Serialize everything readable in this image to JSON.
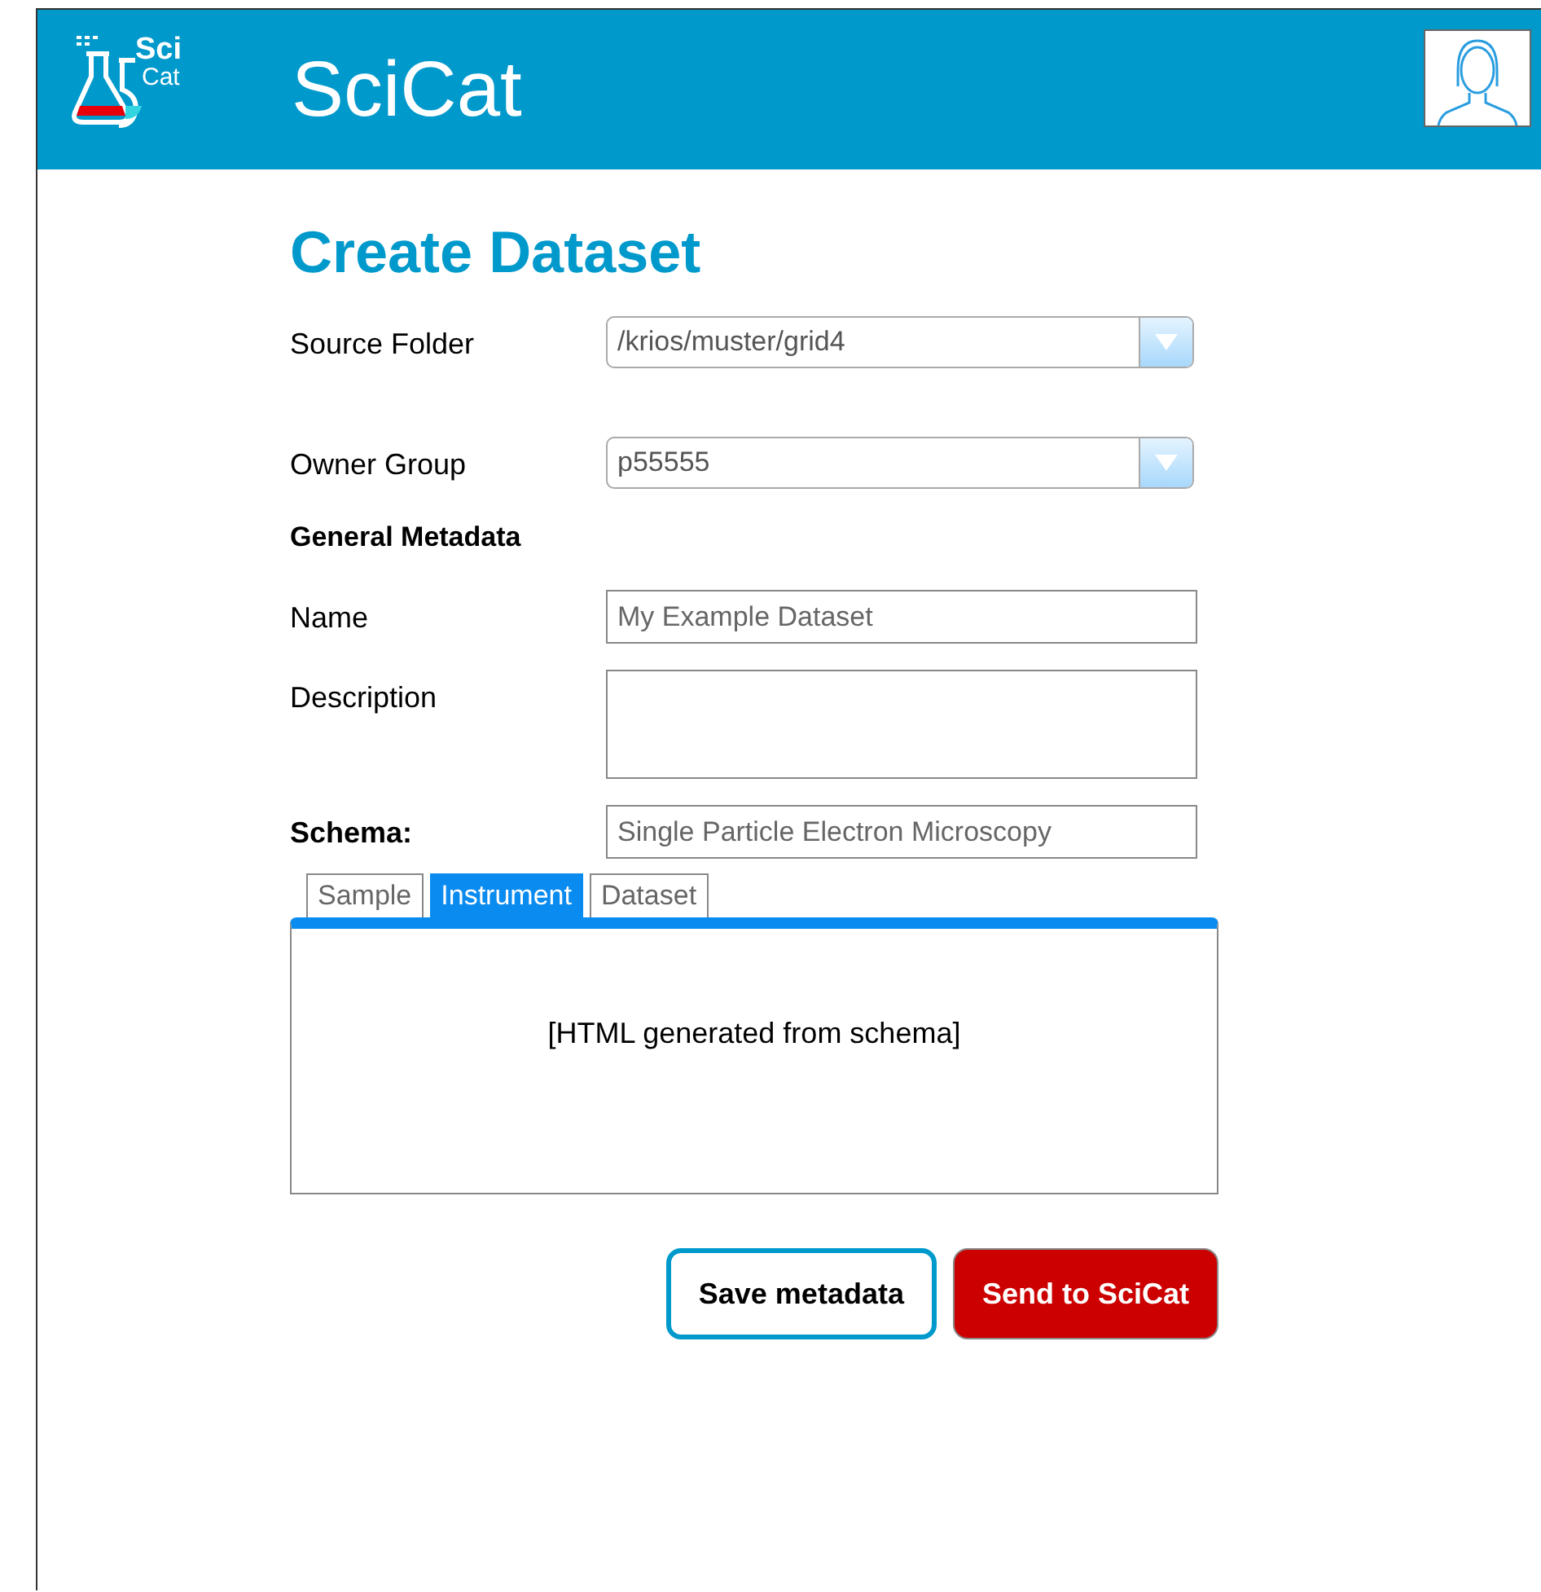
{
  "header": {
    "logo_text": [
      "Sci",
      "Cat"
    ],
    "title": "SciCat"
  },
  "page_title": "Create Dataset",
  "selects": [
    {
      "label": "Source Folder",
      "value": "/krios/muster/grid4"
    },
    {
      "label": "Owner Group",
      "value": "p55555"
    }
  ],
  "section_title": "General Metadata",
  "fields": [
    {
      "label": "Name",
      "value": "My Example Dataset",
      "kind": "line"
    },
    {
      "label": "Description",
      "kind": "area"
    }
  ],
  "schema": {
    "label": "Schema:",
    "value": "Single Particle Electron Microscopy"
  },
  "tabs": [
    {
      "label": "Sample",
      "selected": false
    },
    {
      "label": "Instrument",
      "selected": true
    },
    {
      "label": "Dataset",
      "selected": false
    }
  ],
  "panel_text": "[HTML generated from schema]",
  "buttons": [
    {
      "label": "Save metadata",
      "kind": "secondary"
    },
    {
      "label": "Send to SciCat",
      "kind": "primary"
    }
  ]
}
